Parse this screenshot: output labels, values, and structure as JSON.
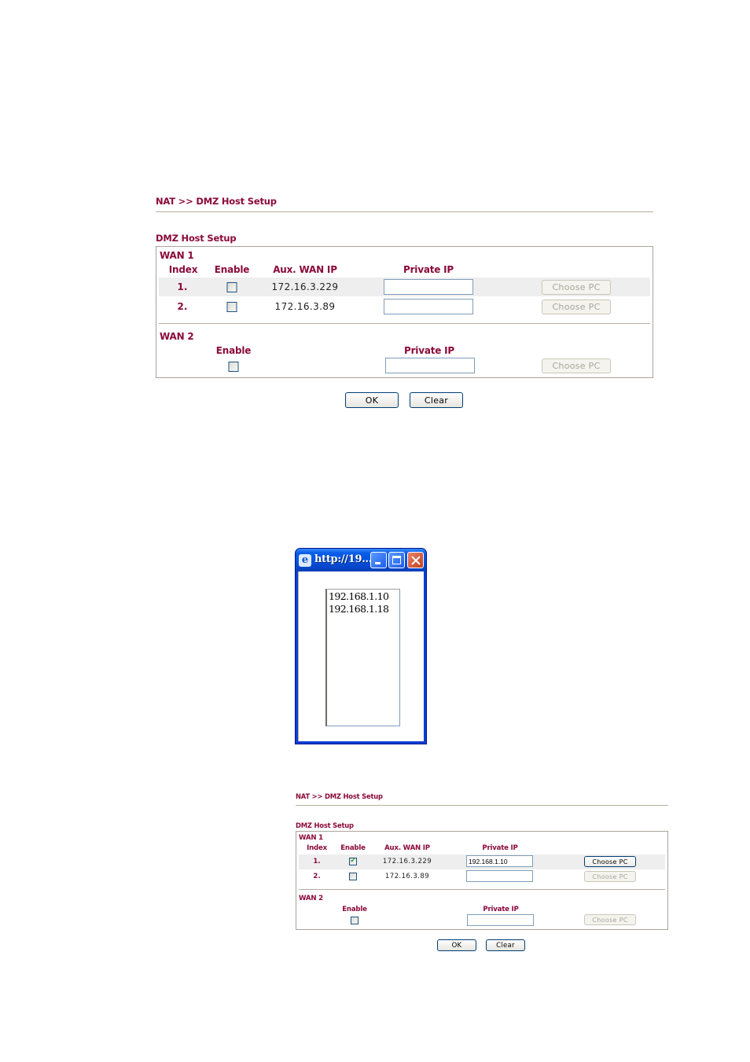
{
  "panel1": {
    "breadcrumb": "NAT >> DMZ Host Setup",
    "section_title": "DMZ Host Setup",
    "wan1": {
      "title": "WAN 1",
      "headers": {
        "index": "Index",
        "enable": "Enable",
        "aux_wan_ip": "Aux. WAN IP",
        "private_ip": "Private IP"
      },
      "rows": [
        {
          "index": "1.",
          "enabled": false,
          "aux_wan_ip": "172.16.3.229",
          "private_ip": "",
          "choose_pc": "Choose PC",
          "choose_pc_enabled": false
        },
        {
          "index": "2.",
          "enabled": false,
          "aux_wan_ip": "172.16.3.89",
          "private_ip": "",
          "choose_pc": "Choose PC",
          "choose_pc_enabled": false
        }
      ]
    },
    "wan2": {
      "title": "WAN 2",
      "headers": {
        "enable": "Enable",
        "private_ip": "Private IP"
      },
      "enabled": false,
      "private_ip": "",
      "choose_pc": "Choose PC",
      "choose_pc_enabled": false
    },
    "ok_label": "OK",
    "clear_label": "Clear"
  },
  "popup": {
    "title": "http://19...",
    "icon": "ie-icon",
    "buttons": [
      "minimize",
      "maximize",
      "close"
    ],
    "list_items": [
      "192.168.1.10",
      "192.168.1.18"
    ]
  },
  "panel2": {
    "breadcrumb": "NAT >> DMZ Host Setup",
    "section_title": "DMZ Host Setup",
    "wan1": {
      "title": "WAN 1",
      "headers": {
        "index": "Index",
        "enable": "Enable",
        "aux_wan_ip": "Aux. WAN IP",
        "private_ip": "Private IP"
      },
      "rows": [
        {
          "index": "1.",
          "enabled": true,
          "aux_wan_ip": "172.16.3.229",
          "private_ip": "192.168.1.10",
          "choose_pc": "Choose PC",
          "choose_pc_enabled": true
        },
        {
          "index": "2.",
          "enabled": false,
          "aux_wan_ip": "172.16.3.89",
          "private_ip": "",
          "choose_pc": "Choose PC",
          "choose_pc_enabled": false
        }
      ]
    },
    "wan2": {
      "title": "WAN 2",
      "headers": {
        "enable": "Enable",
        "private_ip": "Private IP"
      },
      "enabled": false,
      "private_ip": "",
      "choose_pc": "Choose PC",
      "choose_pc_enabled": false
    },
    "ok_label": "OK",
    "clear_label": "Clear"
  },
  "colors": {
    "label_accent": "#8b0a3a",
    "row_shade": "#eeeeee",
    "xp_titlebar": "#0454e2"
  }
}
